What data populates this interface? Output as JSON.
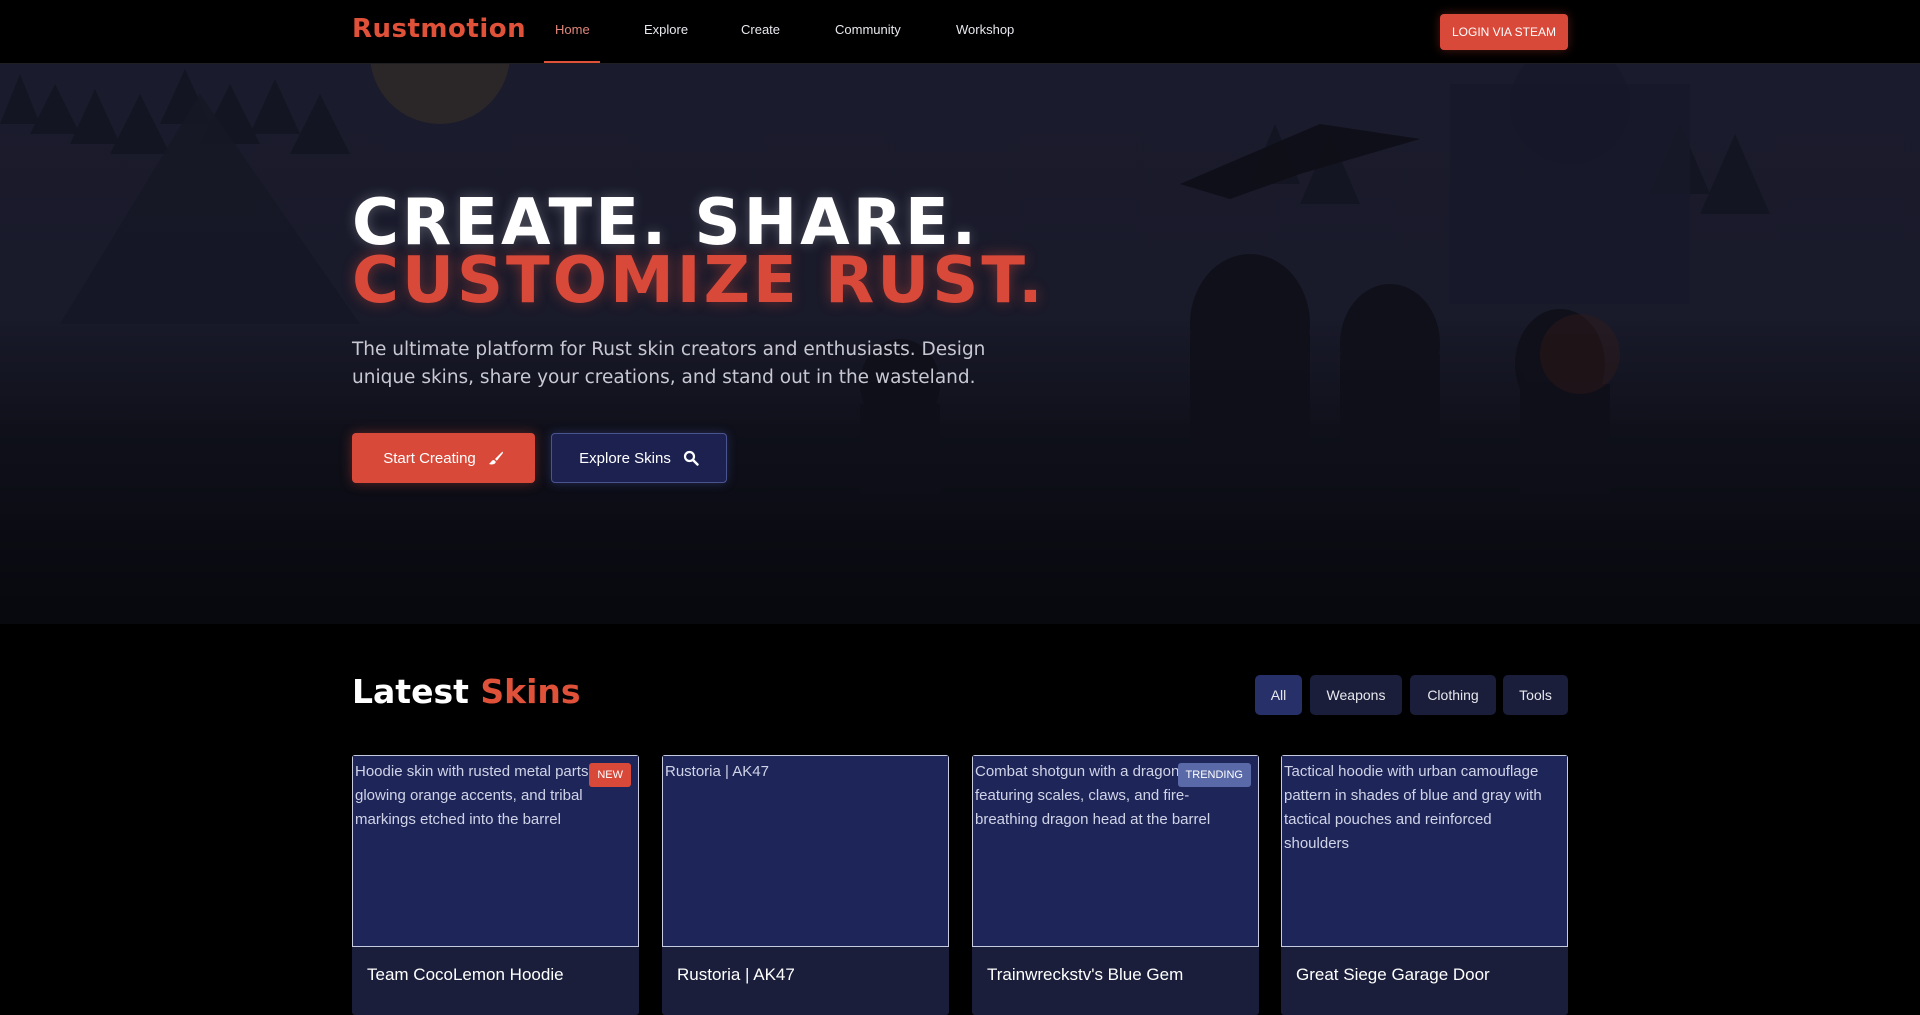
{
  "nav": {
    "logo": "Rustmotion",
    "links": [
      {
        "label": "Home",
        "active": true
      },
      {
        "label": "Explore"
      },
      {
        "label": "Create"
      },
      {
        "label": "Community"
      },
      {
        "label": "Workshop"
      }
    ],
    "login_label": "LOGIN VIA STEAM"
  },
  "hero": {
    "title_line1": "CREATE. SHARE.",
    "title_line2": "CUSTOMIZE RUST.",
    "subtitle": "The ultimate platform for Rust skin creators and enthusiasts. Design unique skins, share your creations, and stand out in the wasteland.",
    "primary_button": "Start Creating",
    "primary_icon": "paintbrush-icon",
    "secondary_button": "Explore Skins",
    "secondary_icon": "search-icon"
  },
  "latest": {
    "title_white": "Latest",
    "title_accent": "Skins",
    "filters": [
      {
        "label": "All",
        "active": true
      },
      {
        "label": "Weapons"
      },
      {
        "label": "Clothing"
      },
      {
        "label": "Tools"
      }
    ],
    "cards": [
      {
        "title": "Team CocoLemon Hoodie",
        "alt": "Hoodie skin with rusted metal parts, glowing orange accents, and tribal markings etched into the barrel",
        "badge": "NEW"
      },
      {
        "title": "Rustoria | AK47",
        "alt": "Rustoria | AK47",
        "badge": ""
      },
      {
        "title": "Trainwreckstv's Blue Gem",
        "alt": "Combat shotgun with a dragon design featuring scales, claws, and fire-breathing dragon head at the barrel",
        "badge": "TRENDING"
      },
      {
        "title": "Great Siege Garage Door",
        "alt": "Tactical hoodie with urban camouflage pattern in shades of blue and gray with tactical pouches and reinforced shoulders",
        "badge": ""
      }
    ]
  },
  "colors": {
    "accent": "#d9493a",
    "card_bg": "#1e2558",
    "secondary": "#1c2150"
  }
}
